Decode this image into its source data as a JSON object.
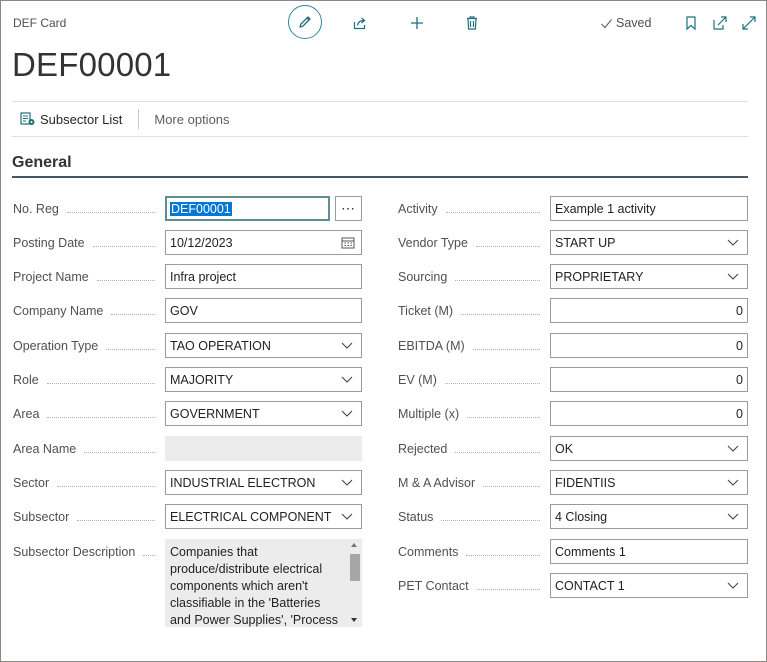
{
  "header": {
    "caption": "DEF Card",
    "title": "DEF00001",
    "saved_label": "Saved",
    "toolbar_icons": [
      "edit-icon",
      "share-icon",
      "plus-icon",
      "delete-icon",
      "bookmark-icon",
      "open-in-new-icon",
      "expand-icon"
    ]
  },
  "actions": {
    "subsector_list": "Subsector List",
    "more_options": "More options"
  },
  "general": {
    "title": "General",
    "left": {
      "no_reg": {
        "label": "No. Reg",
        "value": "DEF00001"
      },
      "posting_date": {
        "label": "Posting Date",
        "value": "10/12/2023"
      },
      "project_name": {
        "label": "Project Name",
        "value": "Infra project"
      },
      "company_name": {
        "label": "Company Name",
        "value": "GOV"
      },
      "operation_type": {
        "label": "Operation Type",
        "value": "TAO OPERATION"
      },
      "role": {
        "label": "Role",
        "value": "MAJORITY"
      },
      "area": {
        "label": "Area",
        "value": "GOVERNMENT"
      },
      "area_name": {
        "label": "Area Name",
        "value": ""
      },
      "sector": {
        "label": "Sector",
        "value": "INDUSTRIAL ELECTRON"
      },
      "subsector": {
        "label": "Subsector",
        "value": "ELECTRICAL COMPONENT"
      },
      "subsector_description": {
        "label": "Subsector Description",
        "value": "Companies that produce/distribute electrical components which aren't classifiable in the 'Batteries and Power Supplies', 'Process"
      }
    },
    "right": {
      "activity": {
        "label": "Activity",
        "value": "Example 1 activity"
      },
      "vendor_type": {
        "label": "Vendor Type",
        "value": "START UP"
      },
      "sourcing": {
        "label": "Sourcing",
        "value": "PROPRIETARY"
      },
      "ticket": {
        "label": "Ticket (M)",
        "value": "0"
      },
      "ebitda": {
        "label": "EBITDA (M)",
        "value": "0"
      },
      "ev": {
        "label": "EV (M)",
        "value": "0"
      },
      "multiple": {
        "label": "Multiple (x)",
        "value": "0"
      },
      "rejected": {
        "label": "Rejected",
        "value": "OK"
      },
      "ma_advisor": {
        "label": "M & A Advisor",
        "value": "FIDENTIIS"
      },
      "status": {
        "label": "Status",
        "value": "4 Closing"
      },
      "comments": {
        "label": "Comments",
        "value": "Comments 1"
      },
      "pet_contact": {
        "label": "PET Contact",
        "value": "CONTACT 1"
      }
    }
  }
}
